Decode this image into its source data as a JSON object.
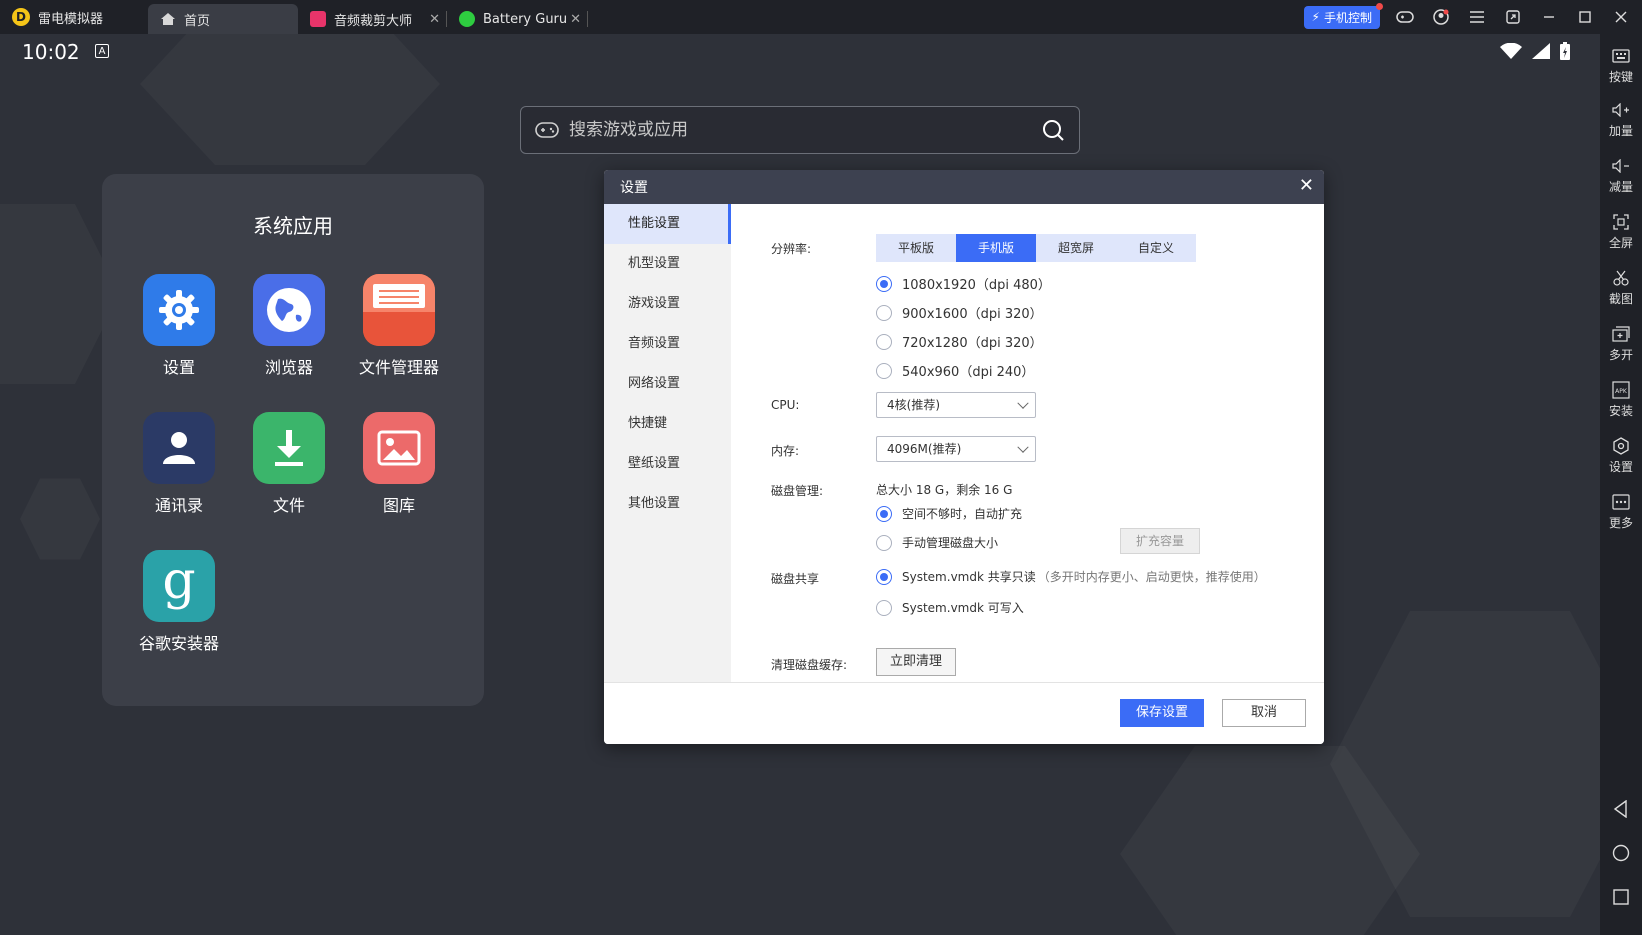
{
  "titlebar": {
    "app_name": "雷电模拟器",
    "tabs": [
      {
        "label": "首页",
        "icon": "home-icon"
      },
      {
        "label": "音频裁剪大师",
        "icon": "audio-app-icon"
      },
      {
        "label": "Battery Guru",
        "icon": "battery-app-icon"
      }
    ],
    "phone_control": "手机控制",
    "tab_close": "✕"
  },
  "statusbar": {
    "time": "10:02",
    "badge": "A"
  },
  "search": {
    "placeholder": "搜索游戏或应用"
  },
  "system_apps": {
    "title": "系统应用",
    "apps": [
      {
        "label": "设置",
        "icon": "settings-icon",
        "color": "#2f7be9"
      },
      {
        "label": "浏览器",
        "icon": "browser-icon",
        "color": "#4a6ee8"
      },
      {
        "label": "文件管理器",
        "icon": "file-manager-icon",
        "color": "#e8543a"
      },
      {
        "label": "通讯录",
        "icon": "contacts-icon",
        "color": "#2b3a66"
      },
      {
        "label": "文件",
        "icon": "download-icon",
        "color": "#3bb56b"
      },
      {
        "label": "图库",
        "icon": "gallery-icon",
        "color": "#ec6a6a"
      },
      {
        "label": "谷歌安装器",
        "icon": "google-installer-icon",
        "color": "#2aa2a8"
      }
    ]
  },
  "sidebar": {
    "items": [
      {
        "label": "按键",
        "icon": "keyboard-icon"
      },
      {
        "label": "加量",
        "icon": "volume-up-icon"
      },
      {
        "label": "减量",
        "icon": "volume-down-icon"
      },
      {
        "label": "全屏",
        "icon": "fullscreen-icon"
      },
      {
        "label": "截图",
        "icon": "scissors-icon"
      },
      {
        "label": "多开",
        "icon": "multi-instance-icon"
      },
      {
        "label": "安装",
        "icon": "apk-install-icon"
      },
      {
        "label": "设置",
        "icon": "gear-icon"
      },
      {
        "label": "更多",
        "icon": "more-icon"
      }
    ]
  },
  "dialog": {
    "title": "设置",
    "close": "✕",
    "nav": [
      "性能设置",
      "机型设置",
      "游戏设置",
      "音频设置",
      "网络设置",
      "快捷键",
      "壁纸设置",
      "其他设置"
    ],
    "resolution": {
      "label": "分辨率:",
      "modes": [
        "平板版",
        "手机版",
        "超宽屏",
        "自定义"
      ],
      "selected_mode": "手机版",
      "options": [
        "1080x1920（dpi 480）",
        "900x1600（dpi 320）",
        "720x1280（dpi 320）",
        "540x960（dpi 240）"
      ],
      "selected_option": "1080x1920（dpi 480）"
    },
    "cpu": {
      "label": "CPU:",
      "value": "4核(推荐)"
    },
    "memory": {
      "label": "内存:",
      "value": "4096M(推荐)"
    },
    "disk": {
      "label": "磁盘管理:",
      "summary": "总大小 18 G，剩余 16 G",
      "auto_expand": "空间不够时，自动扩充",
      "manual": "手动管理磁盘大小",
      "expand_button": "扩充容量"
    },
    "disk_share": {
      "label": "磁盘共享",
      "readonly": "System.vmdk 共享只读",
      "readonly_note": "（多开时内存更小、启动更快，推荐使用）",
      "writable": "System.vmdk 可写入"
    },
    "clear_cache": {
      "label": "清理磁盘缓存:",
      "button": "立即清理"
    },
    "save": "保存设置",
    "cancel": "取消"
  }
}
